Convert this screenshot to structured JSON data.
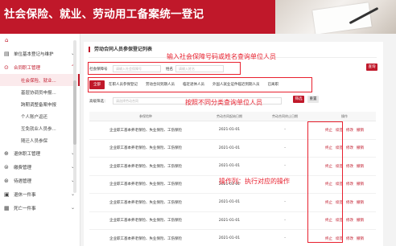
{
  "banner": {
    "title": "社会保险、就业、劳动用工备案统一登记"
  },
  "sidebar": {
    "home_icon": "home-icon",
    "items": [
      {
        "label": "单位基本登记与维护",
        "icon": "building-icon",
        "arrow": "chevron-down-icon",
        "expanded": false
      },
      {
        "label": "合同职工管理",
        "icon": "user-group-icon",
        "arrow": "chevron-up-icon",
        "expanded": true,
        "sub": [
          {
            "label": "社会保险、就业...",
            "active": true
          },
          {
            "label": "基层协调员申报...",
            "active": false
          },
          {
            "label": "跨期调整备案申报",
            "active": false
          },
          {
            "label": "个人账户返还",
            "active": false
          },
          {
            "label": "互免就业人员参...",
            "active": false
          },
          {
            "label": "随迁人员参保",
            "active": false
          }
        ]
      },
      {
        "label": "退休职工管理",
        "icon": "retire-icon",
        "arrow": "chevron-down-icon",
        "expanded": false
      },
      {
        "label": "缴费管理",
        "icon": "payment-icon",
        "arrow": "chevron-down-icon",
        "expanded": false
      },
      {
        "label": "待遇管理",
        "icon": "benefit-icon",
        "arrow": "chevron-down-icon",
        "expanded": false
      },
      {
        "label": "退休一件事",
        "icon": "document-icon",
        "arrow": "chevron-down-icon",
        "expanded": false
      },
      {
        "label": "死亡一件事",
        "icon": "notice-icon",
        "arrow": "chevron-down-icon",
        "expanded": false
      }
    ]
  },
  "main": {
    "title": "劳动合同人员参保登记列表",
    "search": {
      "id_label": "社会保障号",
      "id_placeholder": "请输入社会保障号",
      "name_label": "姓名",
      "name_placeholder": "请输入姓名",
      "query_button": "查询"
    },
    "tabs": [
      "全部",
      "在职人员参保登记",
      "劳动合同到期人员",
      "临近退休人员",
      "外国人就业证件临近到期人员",
      "已离职"
    ],
    "filter": {
      "label": "高级筛选：",
      "placeholder": "请选择劳动合同",
      "confirm_button": "筛选",
      "reset_button": "重置"
    },
    "table": {
      "headers": [
        "参保险种",
        "劳动合同起始日期",
        "劳动合同终止日期",
        "操作"
      ],
      "rows": [
        {
          "insurance": "企业职工基本养老保险、失业保险、工伤保险",
          "start": "2021-01-01",
          "end": "-"
        },
        {
          "insurance": "企业职工基本养老保险、失业保险、工伤保险",
          "start": "2021-01-01",
          "end": "-"
        },
        {
          "insurance": "企业职工基本养老保险、失业保险、工伤保险",
          "start": "2021-01-01",
          "end": "-"
        },
        {
          "insurance": "企业职工基本养老保险、失业保险、工伤保险",
          "start": "2021-01-01",
          "end": "-"
        },
        {
          "insurance": "企业职工基本养老保险、失业保险、工伤保险",
          "start": "2021-01-01",
          "end": "-"
        },
        {
          "insurance": "企业职工基本养老保险、失业保险、工伤保险",
          "start": "2021-01-01",
          "end": "-"
        },
        {
          "insurance": "企业职工基本养老保险、失业保险、工伤保险",
          "start": "2021-01-01",
          "end": "-"
        }
      ],
      "ops": [
        "终止",
        "续签",
        "修改",
        "撤销"
      ]
    }
  },
  "annotations": {
    "search_note": "输入社会保障号码或姓名查询单位人员",
    "tabs_note": "按照不同分类查询单位人员",
    "ops_note": "操作列：执行对应的操作",
    "color": "#e8202e"
  },
  "colors": {
    "brand": "#c0182a",
    "active_bg": "#fbeaec"
  }
}
